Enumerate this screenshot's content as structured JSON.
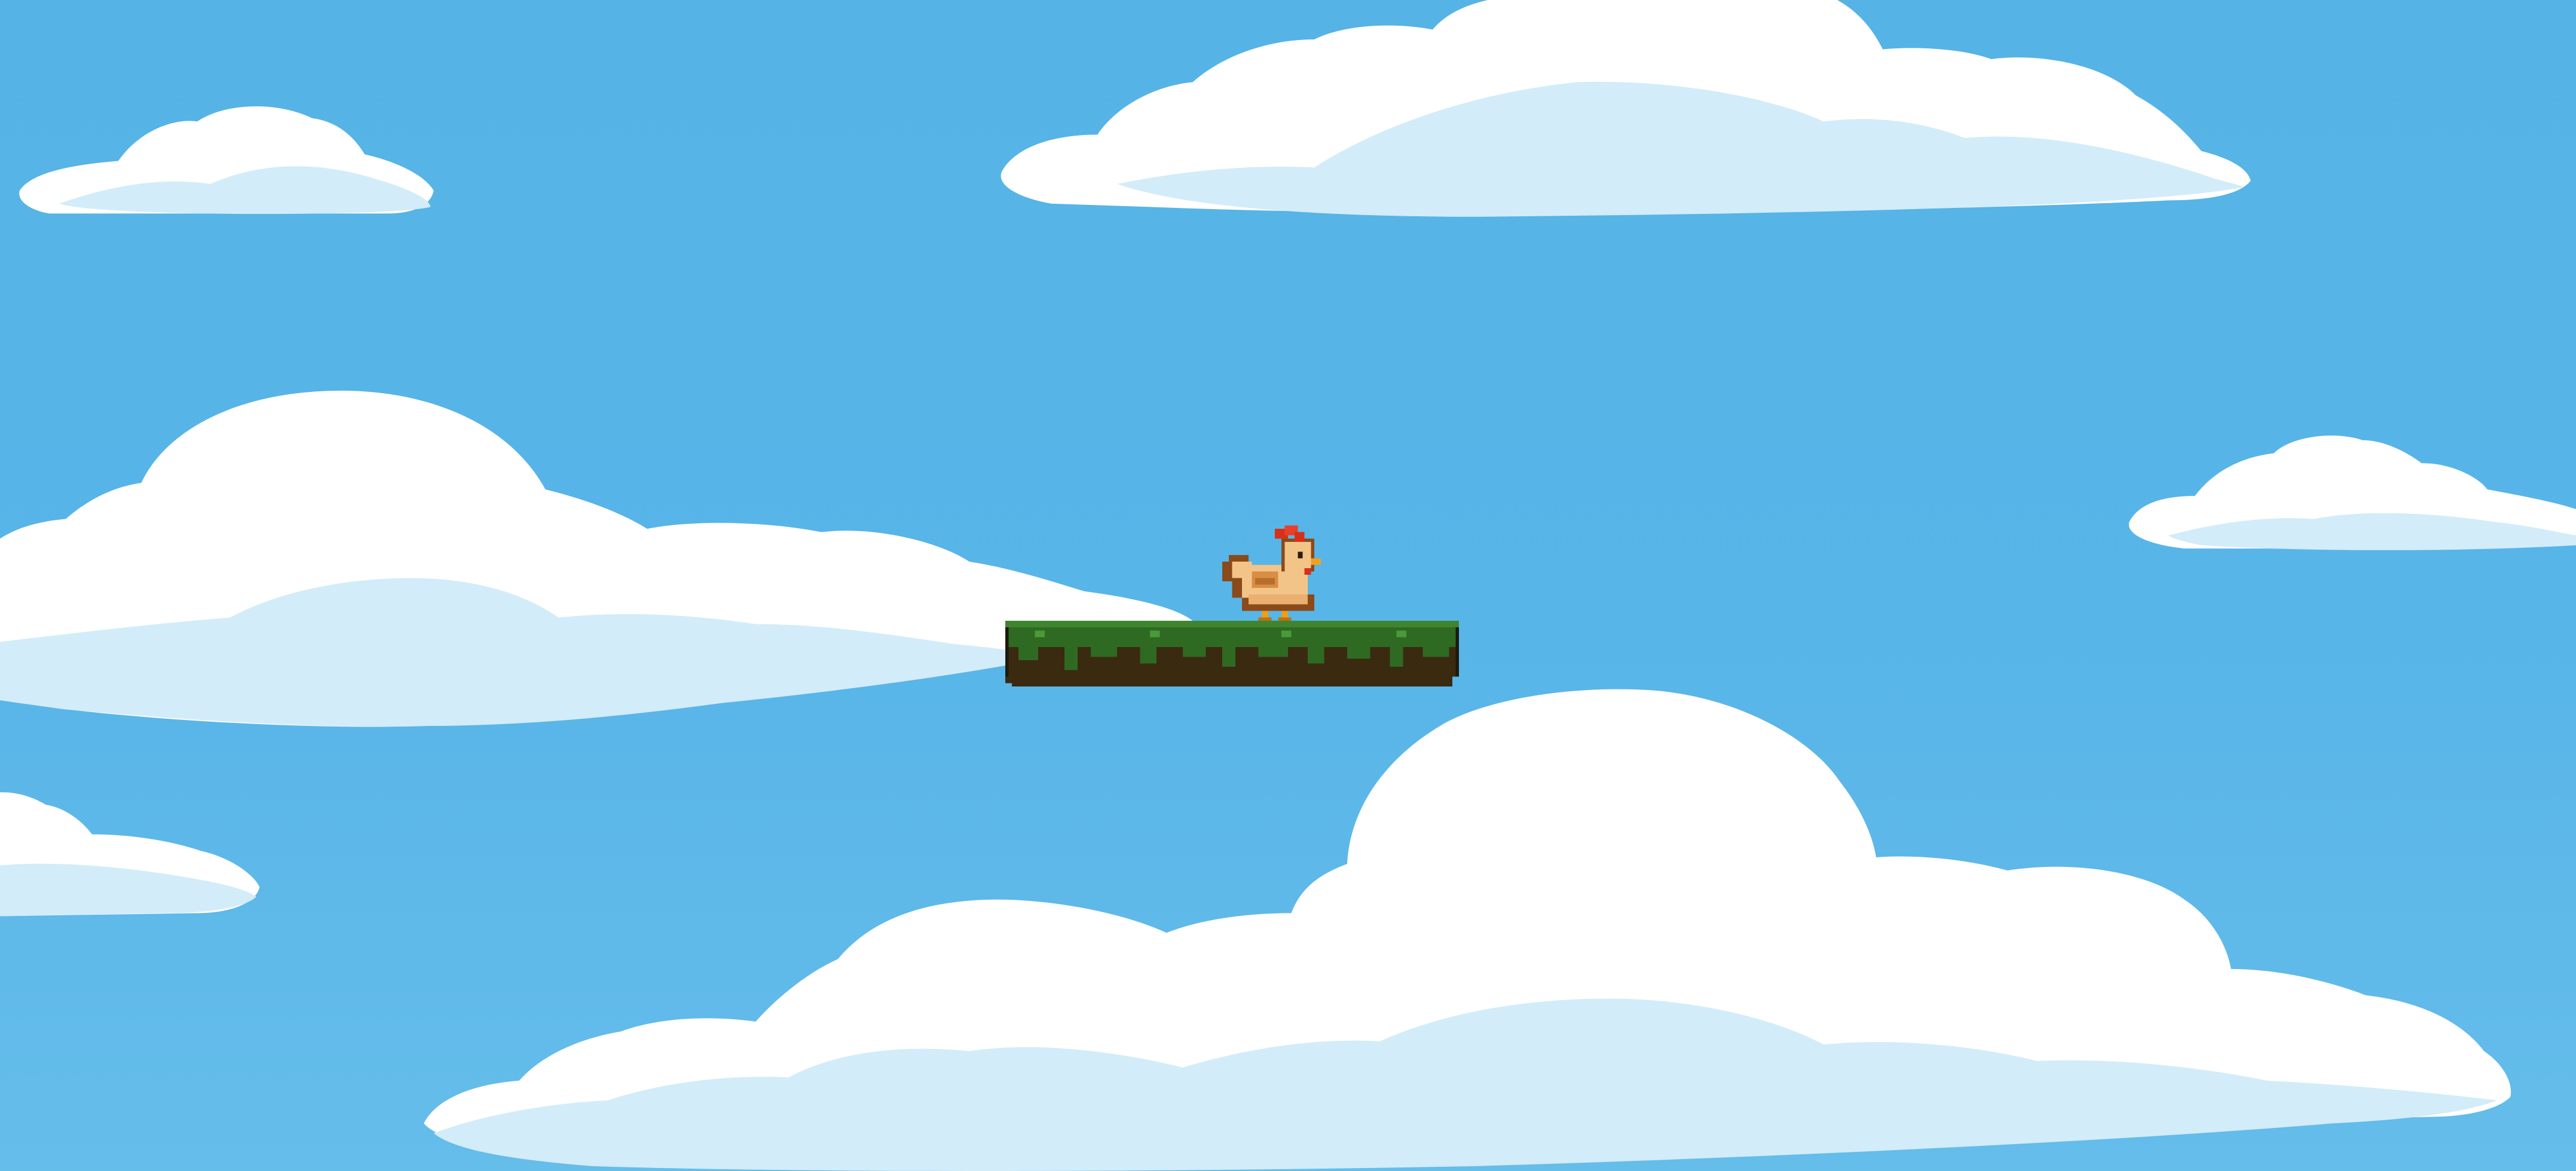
{
  "scene": {
    "sky_color": "#56b4e7",
    "cloud_color": "#ffffff",
    "cloud_shadow_color": "#d3ecf9",
    "clouds": [
      {
        "id": "cloud-top-left"
      },
      {
        "id": "cloud-top-center"
      },
      {
        "id": "cloud-mid-left"
      },
      {
        "id": "cloud-right"
      },
      {
        "id": "cloud-lower-left"
      },
      {
        "id": "cloud-bottom-center"
      }
    ],
    "player": {
      "sprite": "chicken",
      "facing": "right",
      "state": "standing"
    },
    "platform": {
      "type": "floating-grass-platform",
      "grass_color": "#2f6a22",
      "dirt_color": "#3a2a10"
    }
  }
}
